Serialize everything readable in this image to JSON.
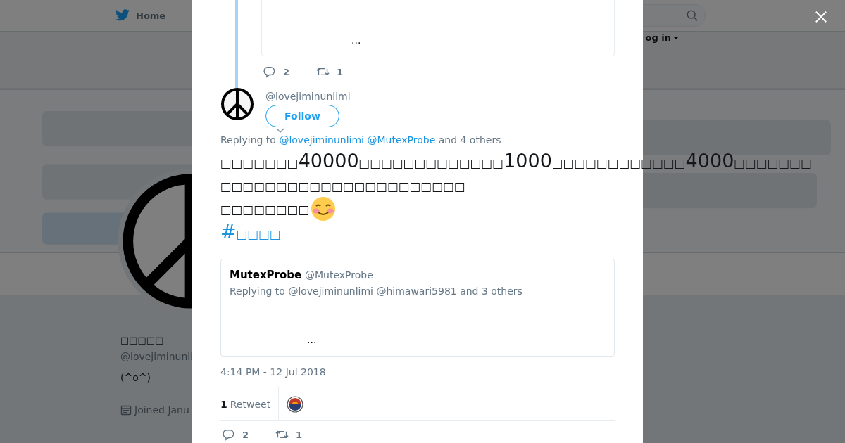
{
  "background_page": {
    "nav": {
      "home": "Home",
      "login": "og in"
    },
    "profile": {
      "name": "□□□□□",
      "handle": "@lovejiminunli",
      "bio": "(^o^)",
      "joined": "Joined Janu"
    }
  },
  "modal": {
    "previous_tweet": {
      "quoted": {
        "ellipsis": "..."
      },
      "replies": "2",
      "retweets": "1"
    },
    "tweet": {
      "handle": "@lovejiminunlimi",
      "follow": "Follow",
      "replying": {
        "prefix": "Replying to",
        "mentions": [
          "@lovejiminunlimi",
          "@MutexProbe"
        ],
        "suffix": "and 4 others"
      },
      "text_lines": [
        "□□□□□□□40000□□□□□□□□□□□□□1000□□□□□□□□□□□□4000□□□□□□□",
        "□□□□□□□□□□□□□□□□□□□□□□",
        "□□□□□□□□"
      ],
      "hashtag": "#□□□□",
      "quoted": {
        "name": "MutexProbe",
        "handle": "@MutexProbe",
        "replying": "Replying to @lovejiminunlimi @himawari5981 and 3 others",
        "ellipsis": "..."
      },
      "time": "4:14 PM - 12 Jul 2018",
      "retweet_count": "1",
      "retweet_label": "Retweet",
      "replies": "2",
      "retweets": "1"
    }
  }
}
